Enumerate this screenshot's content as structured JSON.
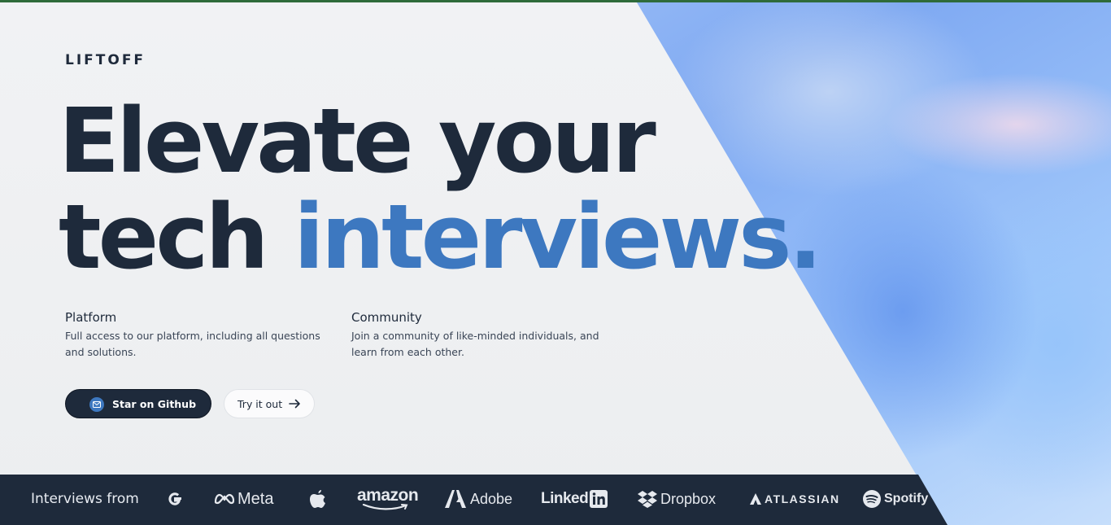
{
  "brand": "LIFTOFF",
  "headline": {
    "line1": "Elevate your",
    "line2_plain": "tech ",
    "line2_accent": "interviews."
  },
  "features": [
    {
      "title": "Platform",
      "description": "Full access to our platform, including all questions and solutions."
    },
    {
      "title": "Community",
      "description": "Join a community of like-minded individuals, and learn from each other."
    }
  ],
  "buttons": {
    "primary": "Star on Github",
    "secondary": "Try it out"
  },
  "companies": {
    "label": "Interviews from",
    "logos": [
      "Meta",
      "amazon",
      "Adobe",
      "Linked",
      "Dropbox",
      "ATLASSIAN",
      "Spotify"
    ]
  },
  "colors": {
    "dark": "#1e2a3b",
    "accent": "#3d78c0",
    "background": "#eff0f2"
  },
  "icons": [
    "mail-icon",
    "arrow-right-icon",
    "google-icon",
    "meta-icon",
    "apple-icon",
    "amazon-icon",
    "adobe-icon",
    "linkedin-icon",
    "dropbox-icon",
    "atlassian-icon",
    "spotify-icon"
  ]
}
